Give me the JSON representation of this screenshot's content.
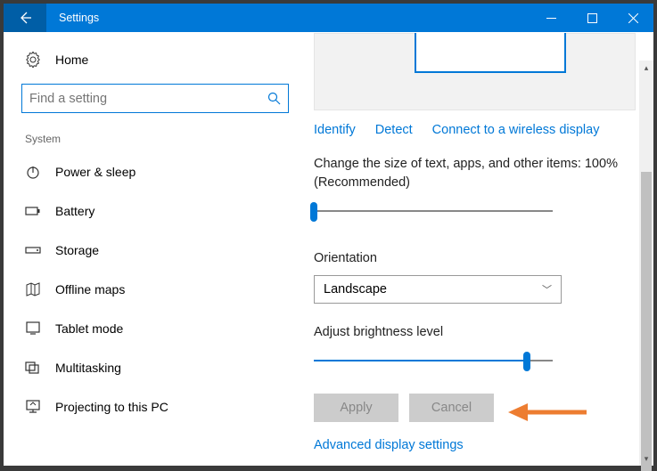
{
  "titlebar": {
    "title": "Settings"
  },
  "sidebar": {
    "home_label": "Home",
    "search_placeholder": "Find a setting",
    "category": "System",
    "items": [
      {
        "label": "Power & sleep"
      },
      {
        "label": "Battery"
      },
      {
        "label": "Storage"
      },
      {
        "label": "Offline maps"
      },
      {
        "label": "Tablet mode"
      },
      {
        "label": "Multitasking"
      },
      {
        "label": "Projecting to this PC"
      }
    ]
  },
  "main": {
    "identify": "Identify",
    "detect": "Detect",
    "connect": "Connect to a wireless display",
    "scale_text": "Change the size of text, apps, and other items: 100% (Recommended)",
    "orientation_label": "Orientation",
    "orientation_value": "Landscape",
    "brightness_label": "Adjust brightness level",
    "apply": "Apply",
    "cancel": "Cancel",
    "advanced": "Advanced display settings",
    "scale_slider_pct": 0,
    "brightness_slider_pct": 86
  },
  "colors": {
    "accent": "#0078d7",
    "annotation": "#ed7d31"
  }
}
